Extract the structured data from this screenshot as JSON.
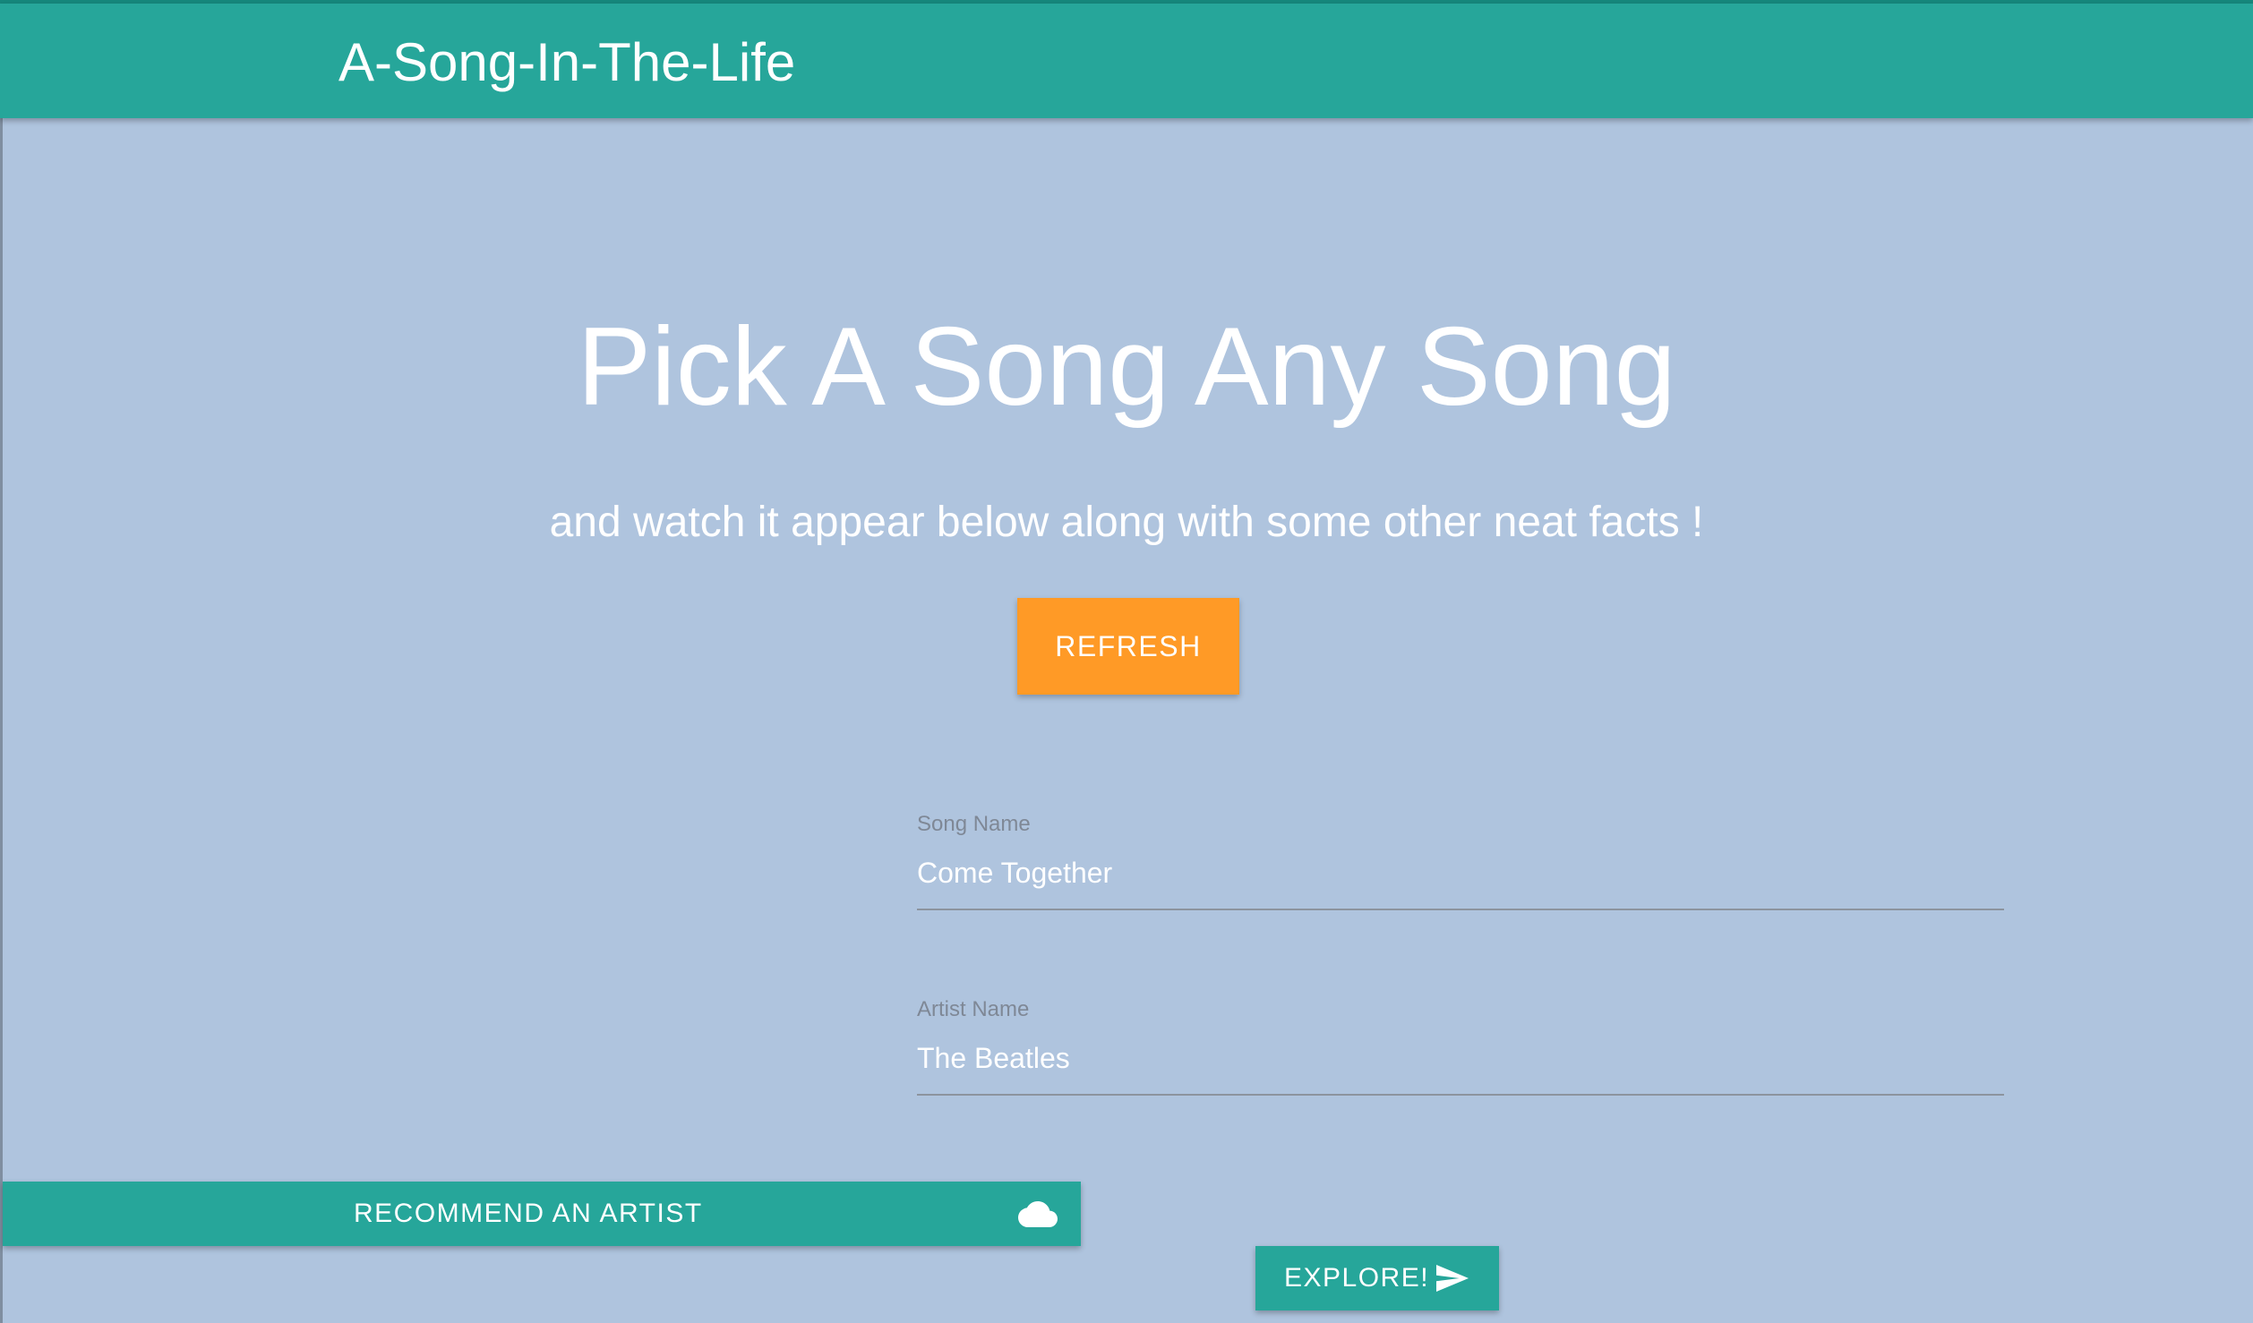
{
  "navbar": {
    "brand": "A-Song-In-The-Life"
  },
  "hero": {
    "title": "Pick A Song Any Song",
    "subtitle": "and watch it appear below along with some other neat facts !",
    "refresh_label": "REFRESH"
  },
  "form": {
    "song": {
      "label": "Song Name",
      "value": "Come Together"
    },
    "artist": {
      "label": "Artist Name",
      "value": "The Beatles"
    }
  },
  "actions": {
    "recommend_label": "RECOMMEND AN ARTIST",
    "recommend_icon": "cloud-icon",
    "explore_label": "EXPLORE!",
    "explore_icon": "send-icon"
  },
  "colors": {
    "background": "#afc4de",
    "primary_teal": "#26a69a",
    "accent_orange": "#ff9a26",
    "text_white": "#ffffff"
  }
}
